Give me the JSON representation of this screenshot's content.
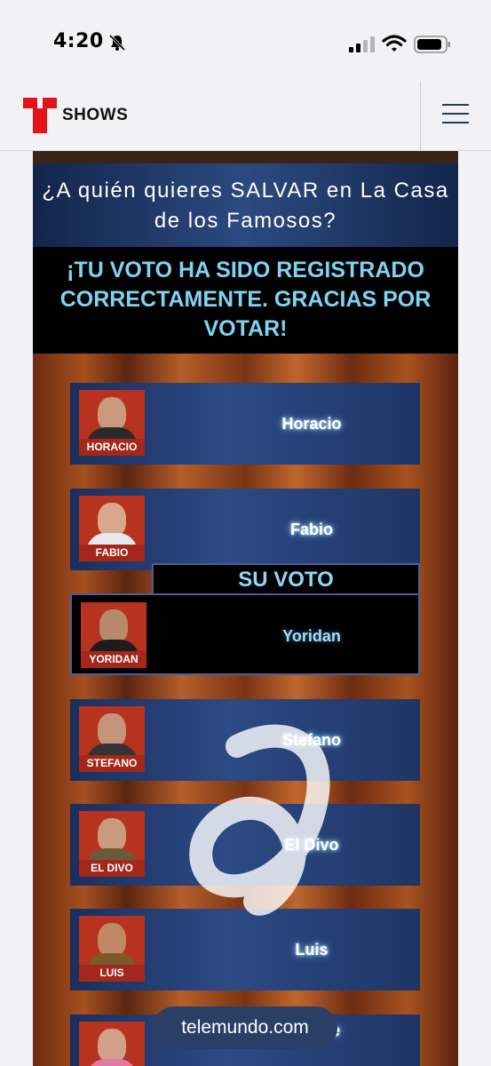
{
  "status_bar": {
    "time": "4:20"
  },
  "nav": {
    "brand": "SHOWS"
  },
  "poll": {
    "question": "¿A quién quieres SALVAR en La Casa de los Famosos?",
    "confirmation": "¡TU VOTO HA SIDO REGISTRADO CORRECTAMENTE. GRACIAS POR VOTAR!",
    "selected_label": "SU VOTO",
    "contestants": [
      {
        "name": "Horacio",
        "tag": "HORACIO"
      },
      {
        "name": "Fabio",
        "tag": "FABIO"
      },
      {
        "name": "Yoridan",
        "tag": "YORIDAN",
        "selected": true
      },
      {
        "name": "Stefano",
        "tag": "STEFANO"
      },
      {
        "name": "El Divo",
        "tag": "EL DIVO"
      },
      {
        "name": "Luis",
        "tag": "LUIS"
      },
      {
        "name": "Celinee",
        "tag": ""
      }
    ]
  },
  "url_pill": "telemundo.com",
  "colors": {
    "brand_red": "#e3121b",
    "card_blue": "#2c4a84",
    "confirm_cyan": "#7fd3f3"
  }
}
